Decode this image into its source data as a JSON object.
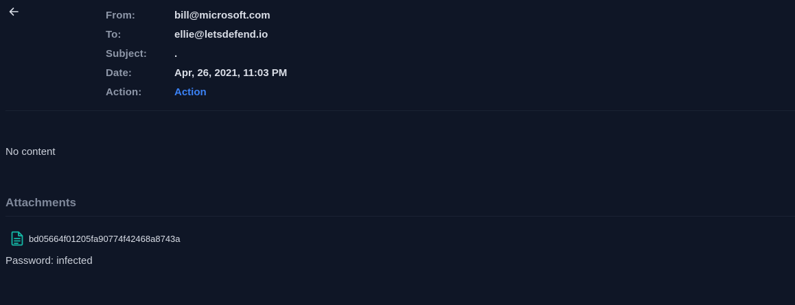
{
  "header": {
    "rows": [
      {
        "label": "From:",
        "value": "bill@microsoft.com"
      },
      {
        "label": "To:",
        "value": "ellie@letsdefend.io"
      },
      {
        "label": "Subject:",
        "value": "."
      },
      {
        "label": "Date:",
        "value": "Apr, 26, 2021, 11:03 PM"
      },
      {
        "label": "Action:",
        "value": "Action"
      }
    ]
  },
  "body": {
    "text": "No content"
  },
  "attachments": {
    "heading": "Attachments",
    "items": [
      {
        "name": "bd05664f01205fa90774f42468a8743a",
        "icon": "file-document-icon"
      }
    ],
    "password": "Password: infected"
  },
  "icons": {
    "back": "arrow-left-icon"
  },
  "colors": {
    "background": "#0f1626",
    "accent_link": "#3b82f6",
    "file_icon": "#14b8a6",
    "label": "#8e97a8",
    "value": "#d9dde6"
  }
}
